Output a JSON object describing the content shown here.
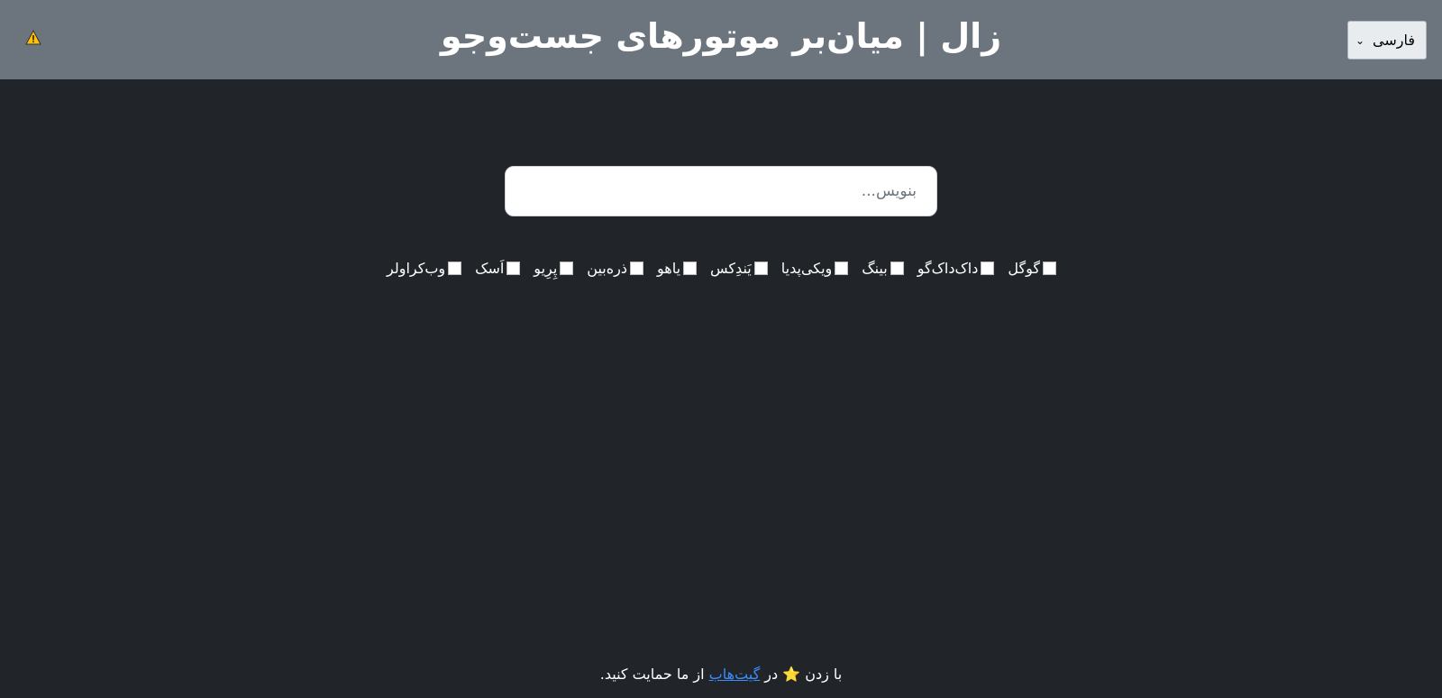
{
  "header": {
    "title": "زال | میان‌بر موتورهای جست‌وجو",
    "warning_icon": "warning-icon",
    "language_select": {
      "selected": "فارسی"
    }
  },
  "search": {
    "placeholder": "بنویس...",
    "value": ""
  },
  "engines": [
    {
      "label": "گوگل",
      "checked": false
    },
    {
      "label": "داک‌داک‌گو",
      "checked": false
    },
    {
      "label": "بینگ",
      "checked": false
    },
    {
      "label": "ویکی‌پدیا",
      "checked": false
    },
    {
      "label": "یَندِکس",
      "checked": false
    },
    {
      "label": "یاهو",
      "checked": false
    },
    {
      "label": "ذره‌بین",
      "checked": false
    },
    {
      "label": "پِرِیو",
      "checked": false
    },
    {
      "label": "اَسک",
      "checked": false
    },
    {
      "label": "وب‌کراولر",
      "checked": false
    }
  ],
  "footer": {
    "text_before": "با زدن ",
    "star": "⭐",
    "text_middle": " در ",
    "link_label": "گیت‌هاب",
    "text_after": " از ما حمایت کنید."
  },
  "colors": {
    "header_bg": "#6c757d",
    "page_bg": "#212529",
    "link": "#3d8bfd",
    "warning": "#ffc107"
  }
}
